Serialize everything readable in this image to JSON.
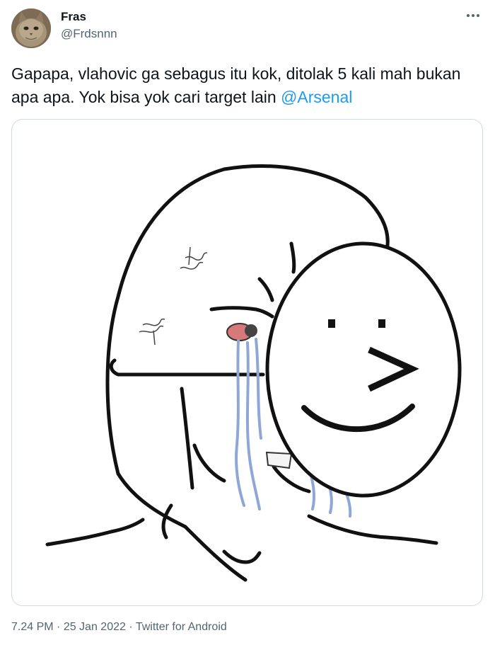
{
  "author": {
    "display_name": "Fras",
    "handle": "@Frdsnnn",
    "avatar_icon": "cat-avatar"
  },
  "tweet": {
    "text_before_mention": "Gapapa, vlahovic ga sebagus itu kok, ditolak 5 kali mah bukan apa apa. Yok bisa yok cari target lain ",
    "mention": "@Arsenal"
  },
  "media": {
    "description_icon": "crying-wojak-smiley-mask-meme"
  },
  "meta": {
    "time": "7.24 PM",
    "separator": " · ",
    "date": "25 Jan 2022",
    "source": "Twitter for Android"
  },
  "colors": {
    "text": "#0f1419",
    "secondary": "#536471",
    "link": "#1d9bf0",
    "border": "#cfd9de",
    "tears": "#8fa7d6"
  }
}
